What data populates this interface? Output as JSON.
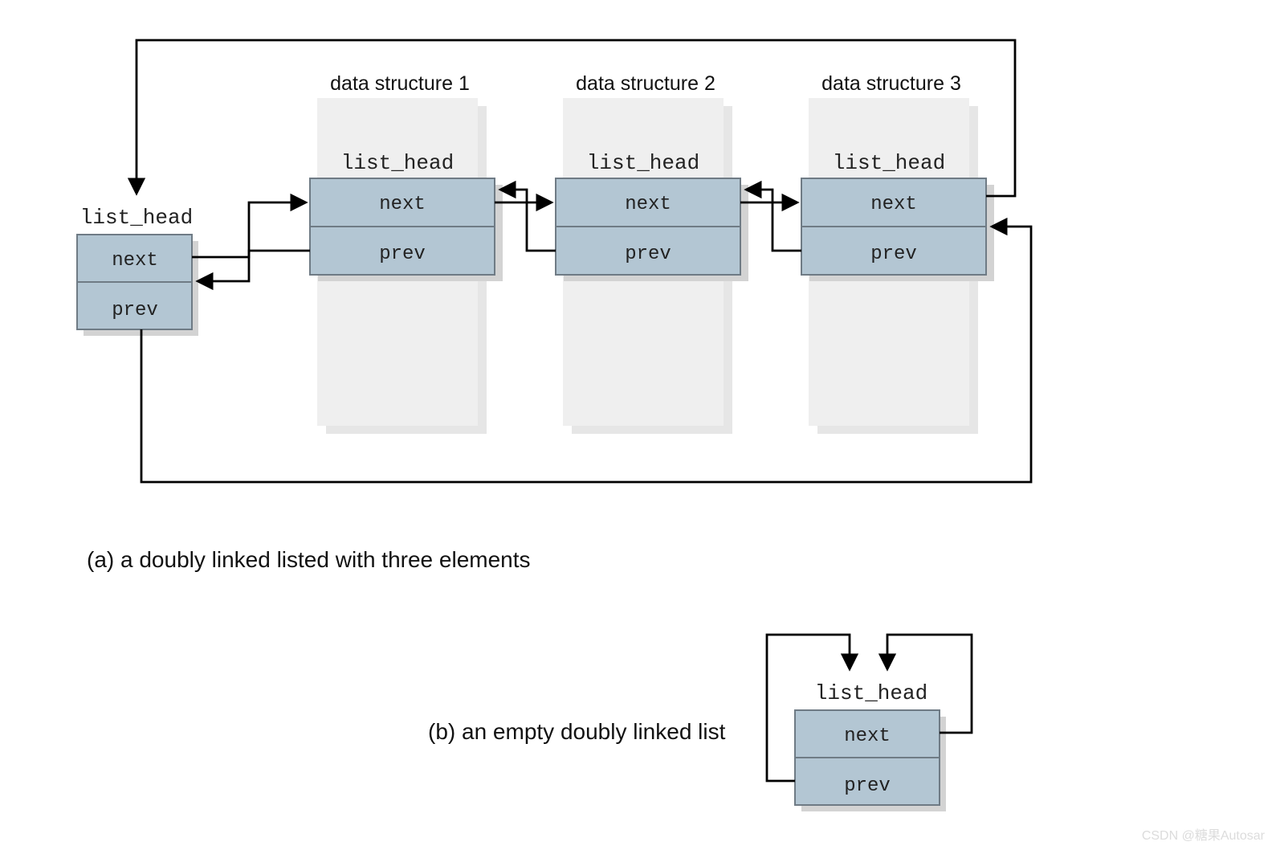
{
  "diagram": {
    "head": {
      "label": "list_head",
      "next": "next",
      "prev": "prev"
    },
    "structs": [
      {
        "title": "data structure 1",
        "listhead": "list_head",
        "next": "next",
        "prev": "prev"
      },
      {
        "title": "data structure 2",
        "listhead": "list_head",
        "next": "next",
        "prev": "prev"
      },
      {
        "title": "data structure 3",
        "listhead": "list_head",
        "next": "next",
        "prev": "prev"
      }
    ],
    "captions": {
      "a": "(a)  a doubly linked listed with three elements",
      "b": "(b)  an empty doubly linked list"
    },
    "empty": {
      "label": "list_head",
      "next": "next",
      "prev": "prev"
    },
    "watermark": "CSDN @糖果Autosar",
    "colors": {
      "node": "#b3c6d3",
      "nodeBorder": "#6f7b85",
      "container": "#efefef",
      "shadow": "#d3d3d3"
    }
  }
}
